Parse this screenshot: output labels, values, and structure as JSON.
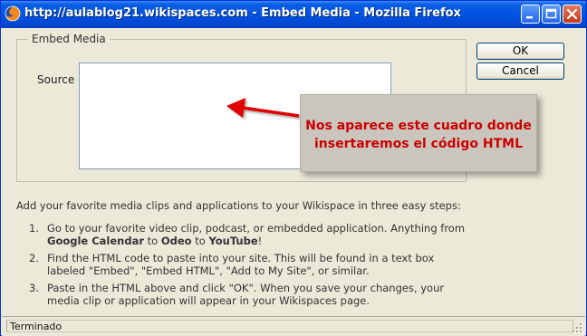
{
  "window": {
    "title": "http://aulablog21.wikispaces.com - Embed Media - Mozilla Firefox",
    "minimize_label": "minimize",
    "maximize_label": "maximize",
    "close_label": "close"
  },
  "dialog": {
    "legend": "Embed Media",
    "source_label": "Source",
    "source_value": "",
    "ok_label": "OK",
    "cancel_label": "Cancel",
    "intro": "Add your favorite media clips and applications to your Wikispace in three easy steps:",
    "steps": [
      {
        "number": "1.",
        "text_a": "Go to your favorite video clip, podcast, or embedded application. Anything from",
        "link1": "Google Calendar",
        "to1": " to ",
        "link2": "Odeo",
        "to2": " to ",
        "link3": "YouTube",
        "end": "!"
      },
      {
        "number": "2.",
        "text": "Find the HTML code to paste into your site. This will be found in a text box labeled \"Embed\", \"Embed HTML\", \"Add to My Site\", or similar."
      },
      {
        "number": "3.",
        "text": "Paste in the HTML above and click \"OK\". When you save your changes, your media clip or application will appear in your Wikispaces page."
      }
    ]
  },
  "status": {
    "text": "Terminado"
  },
  "annotation": {
    "line1": "Nos aparece este cuadro donde",
    "line2": "insertaremos el código HTML",
    "text_color": "#cc0000",
    "arrow_color": "#e00000"
  },
  "colors": {
    "titlebar": "#0054e3",
    "window_bg": "#ece9d8",
    "close_button": "#c3381b"
  }
}
